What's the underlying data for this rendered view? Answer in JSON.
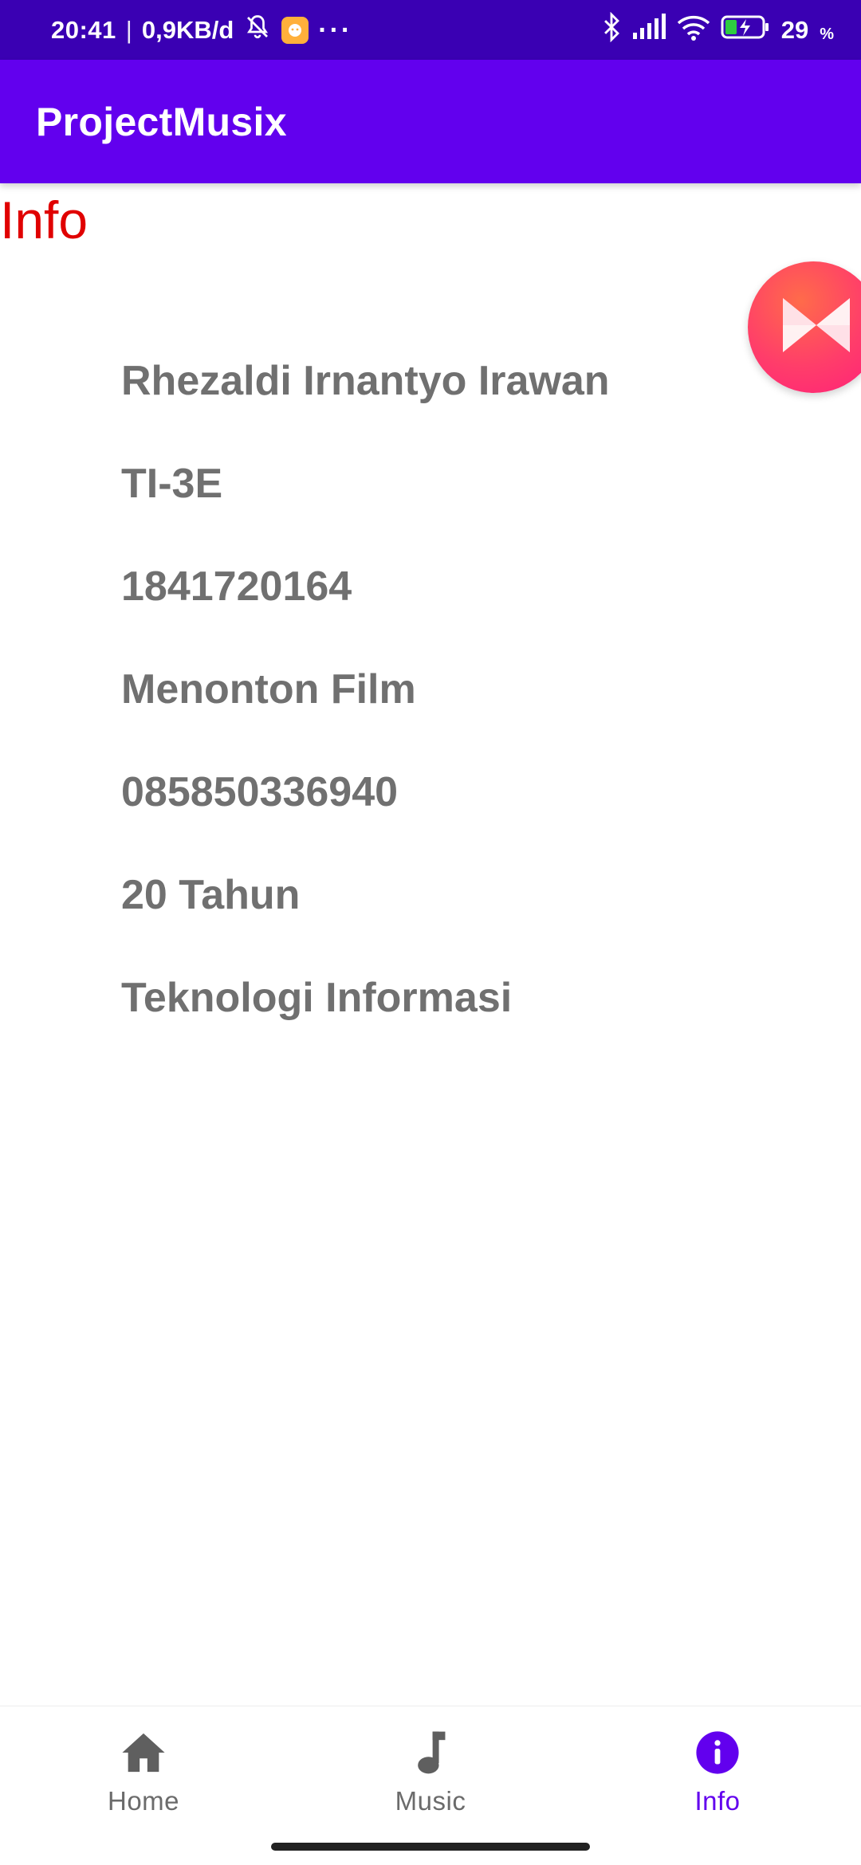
{
  "status_bar": {
    "time": "20:41",
    "separator": "|",
    "net_speed": "0,9KB/d",
    "more": "···",
    "battery_percent": "29",
    "battery_unit": "%",
    "icons": [
      "bell-muted-icon",
      "app-notification-icon",
      "bluetooth-icon",
      "signal-icon",
      "wifi-icon",
      "battery-charging-icon"
    ]
  },
  "app_bar": {
    "title": "ProjectMusix"
  },
  "page": {
    "heading": "Info",
    "items": [
      "Rhezaldi Irnantyo Irawan",
      "TI-3E",
      "1841720164",
      "Menonton Film",
      "085850336940",
      "20 Tahun",
      "Teknologi Informasi"
    ]
  },
  "bottom_nav": {
    "items": [
      {
        "label": "Home",
        "icon": "home-icon",
        "active": false
      },
      {
        "label": "Music",
        "icon": "music-note-icon",
        "active": false
      },
      {
        "label": "Info",
        "icon": "info-icon",
        "active": true
      }
    ]
  },
  "colors": {
    "status_bar": "#3a00b3",
    "app_bar": "#6200ee",
    "heading": "#e00000",
    "item_text": "#707070",
    "nav_active": "#6200ee",
    "nav_inactive": "#6b6b6b"
  }
}
